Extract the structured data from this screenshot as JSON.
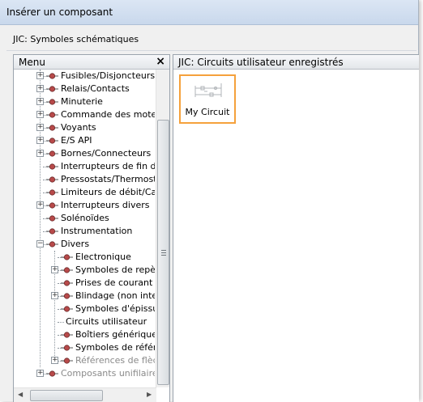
{
  "window": {
    "title": "Insérer un composant"
  },
  "library": {
    "label": "JIC: Symboles schématiques"
  },
  "menu_panel": {
    "header": "Menu",
    "close_glyph": "×",
    "items": [
      {
        "label": "Fusibles/Disjoncteurs/T",
        "expander": "+",
        "level": 0
      },
      {
        "label": "Relais/Contacts",
        "expander": "+",
        "level": 0
      },
      {
        "label": "Minuterie",
        "expander": "+",
        "level": 0
      },
      {
        "label": "Commande des moteur",
        "expander": "+",
        "level": 0
      },
      {
        "label": "Voyants",
        "expander": "+",
        "level": 0
      },
      {
        "label": "E/S API",
        "expander": "+",
        "level": 0
      },
      {
        "label": "Bornes/Connecteurs",
        "expander": "+",
        "level": 0
      },
      {
        "label": "Interrupteurs de fin de c",
        "expander": "",
        "level": 0
      },
      {
        "label": "Pressostats/Thermosta",
        "expander": "",
        "level": 0
      },
      {
        "label": "Limiteurs de débit/Capt",
        "expander": "",
        "level": 0
      },
      {
        "label": "Interrupteurs divers",
        "expander": "+",
        "level": 0
      },
      {
        "label": "Solénoïdes",
        "expander": "",
        "level": 0
      },
      {
        "label": "Instrumentation",
        "expander": "",
        "level": 0
      },
      {
        "label": "Divers",
        "expander": "−",
        "level": 0
      },
      {
        "label": "Electronique",
        "expander": "",
        "level": 1
      },
      {
        "label": "Symboles de repère",
        "expander": "+",
        "level": 1
      },
      {
        "label": "Prises de courant",
        "expander": "",
        "level": 1
      },
      {
        "label": "Blindage (non intell",
        "expander": "+",
        "level": 1
      },
      {
        "label": "Symboles d'épissur",
        "expander": "",
        "level": 1
      },
      {
        "label": "Circuits utilisateur",
        "expander": "",
        "level": 1,
        "no_icon": true
      },
      {
        "label": "Boîtiers génériques",
        "expander": "",
        "level": 1
      },
      {
        "label": "Symboles de référe",
        "expander": "",
        "level": 1
      },
      {
        "label": "Références de flèc",
        "expander": "+",
        "level": 1,
        "disabled": true
      },
      {
        "label": "Composants unifilaires",
        "expander": "+",
        "level": 0,
        "disabled": true
      }
    ]
  },
  "content_panel": {
    "header": "JIC: Circuits utilisateur enregistrés",
    "items": [
      {
        "caption": "My Circuit"
      }
    ]
  },
  "colors": {
    "selection_border": "#f5a13c",
    "bullet": "#b84a4a"
  }
}
